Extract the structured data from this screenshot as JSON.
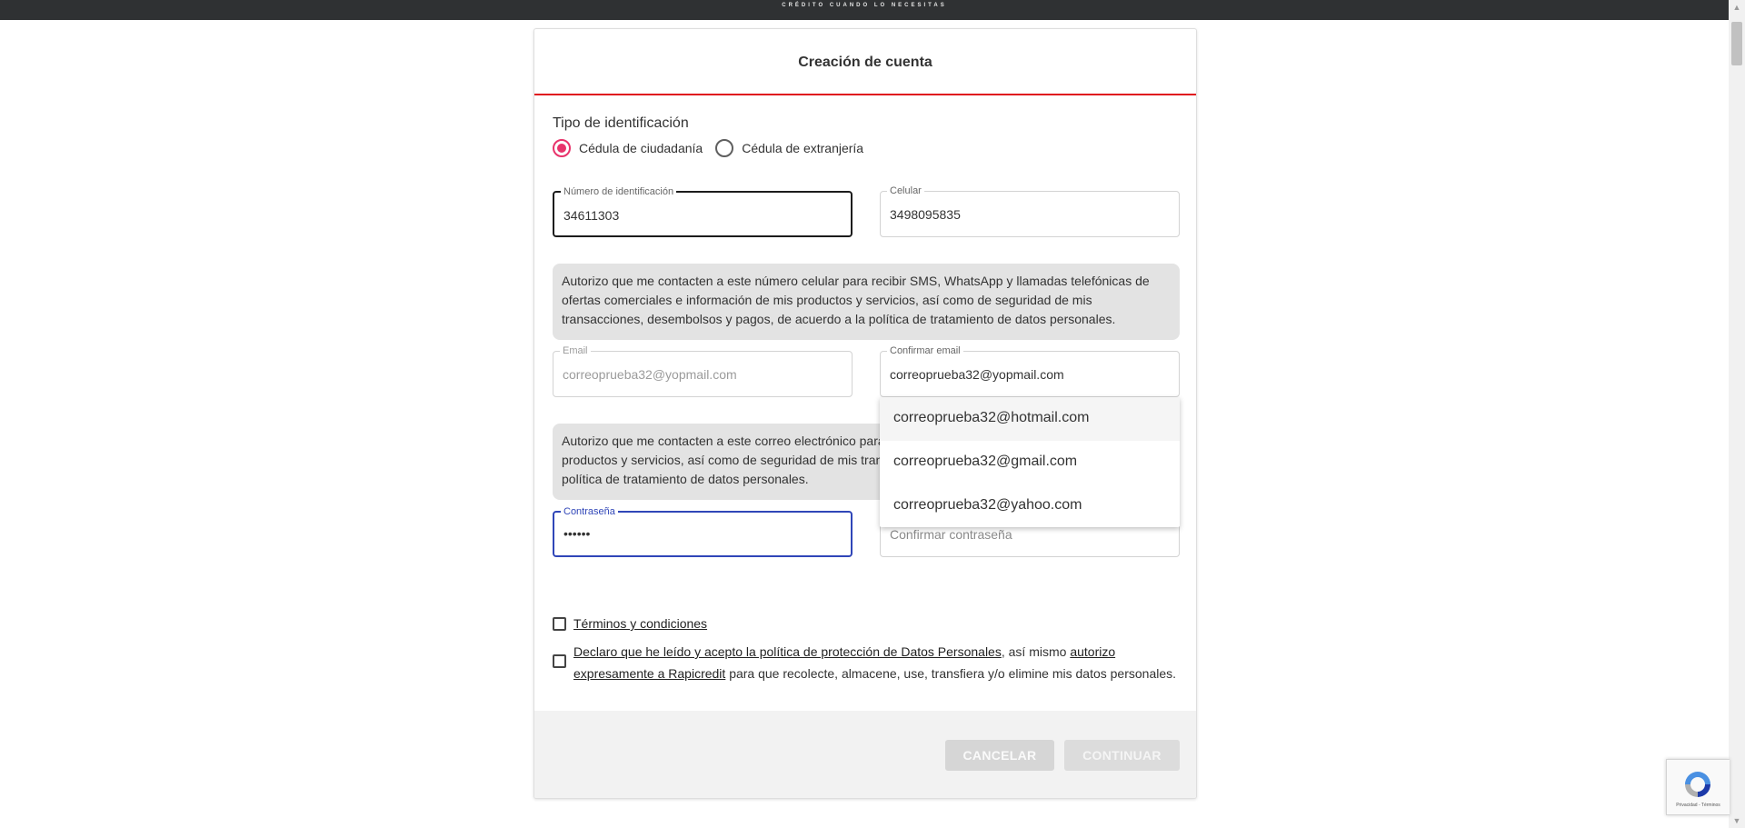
{
  "topbar": {
    "tagline": "CRÉDITO CUANDO LO NECESITAS"
  },
  "card": {
    "title": "Creación de cuenta"
  },
  "id_type": {
    "label": "Tipo de identificación",
    "options": [
      "Cédula de ciudadanía",
      "Cédula de extranjería"
    ],
    "selected": "Cédula de ciudadanía"
  },
  "fields": {
    "id_number": {
      "label": "Número de identificación",
      "value": "34611303"
    },
    "phone": {
      "label": "Celular",
      "value": "3498095835"
    },
    "email": {
      "label": "Email",
      "value": "correoprueba32@yopmail.com"
    },
    "confirm_email": {
      "label": "Confirmar email",
      "value": "correoprueba32@yopmail.com"
    },
    "password": {
      "label": "Contraseña",
      "value": "••••••"
    },
    "confirm_password": {
      "placeholder": "Confirmar contraseña"
    }
  },
  "notices": {
    "phone_consent": "Autorizo que me contacten a este número celular para recibir SMS, WhatsApp y llamadas telefónicas de ofertas comerciales e información de mis productos y servicios, así como de seguridad de mis transacciones, desembolsos y pagos, de acuerdo a la política de tratamiento de datos personales.",
    "email_consent": "Autorizo que me contacten a este correo electrónico para recibir ofertas comerciales e información de mis productos y servicios, así como de seguridad de mis transacciones, desembolsos y pagos, de acuerdo a la política de tratamiento de datos personales."
  },
  "email_suggestions": [
    "correoprueba32@hotmail.com",
    "correoprueba32@gmail.com",
    "correoprueba32@yahoo.com"
  ],
  "checks": {
    "terms_link": "Términos y condiciones",
    "privacy_link": "Declaro que he leído y acepto la política de protección de Datos Personales",
    "privacy_mid": ", así mismo ",
    "authorize_link_1": "autorizo",
    "authorize_link_2": "expresamente a Rapicredit",
    "privacy_tail": " para que recolecte, almacene, use, transfiera y/o elimine mis datos personales."
  },
  "buttons": {
    "cancel": "CANCELAR",
    "continue": "CONTINUAR"
  },
  "recaptcha": {
    "links": "Privacidad - Términos"
  },
  "colors": {
    "accent_red": "#e0141e",
    "radio_pink": "#e8336b",
    "focus_blue": "#3046b8",
    "topbar": "#2f3133"
  }
}
